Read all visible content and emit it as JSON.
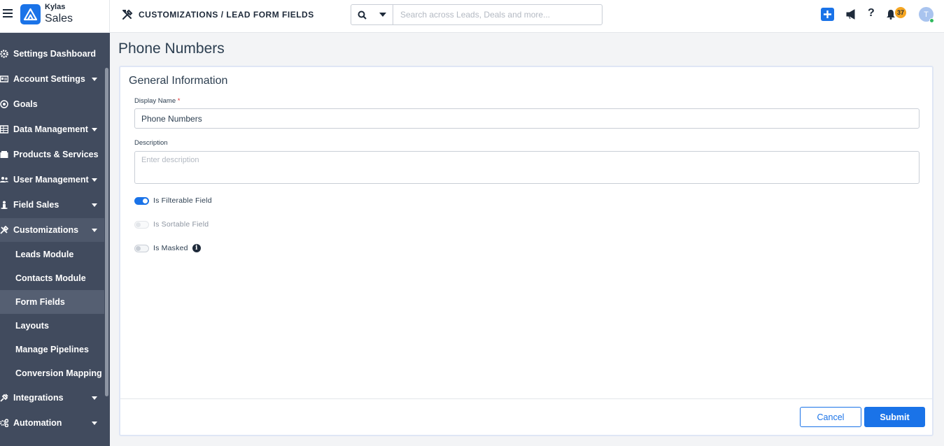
{
  "header": {
    "brand_small": "Kylas",
    "brand_big": "Sales",
    "breadcrumb": "CUSTOMIZATIONS / LEAD FORM FIELDS",
    "search_placeholder": "Search across Leads, Deals and more...",
    "notification_count": "37",
    "avatar_initial": "T"
  },
  "sidebar": {
    "items": [
      {
        "label": "Settings Dashboard",
        "icon": "gear-icon",
        "has_caret": false
      },
      {
        "label": "Account Settings",
        "icon": "id-card-icon",
        "has_caret": true
      },
      {
        "label": "Goals",
        "icon": "target-icon",
        "has_caret": false
      },
      {
        "label": "Data Management",
        "icon": "table-icon",
        "has_caret": true
      },
      {
        "label": "Products & Services",
        "icon": "box-icon",
        "has_caret": false
      },
      {
        "label": "User Management",
        "icon": "users-icon",
        "has_caret": true
      },
      {
        "label": "Field Sales",
        "icon": "person-pin-icon",
        "has_caret": true
      },
      {
        "label": "Customizations",
        "icon": "tools-icon",
        "has_caret": true,
        "active": true
      },
      {
        "label": "Integrations",
        "icon": "plug-icon",
        "has_caret": true
      },
      {
        "label": "Automation",
        "icon": "cogs-icon",
        "has_caret": true
      }
    ],
    "customizations_sub": [
      {
        "label": "Leads Module"
      },
      {
        "label": "Contacts Module"
      },
      {
        "label": "Form Fields",
        "active": true
      },
      {
        "label": "Layouts"
      },
      {
        "label": "Manage Pipelines"
      },
      {
        "label": "Conversion Mapping"
      }
    ]
  },
  "main": {
    "page_title": "Phone Numbers",
    "section_title": "General Information",
    "display_name_label": "Display Name",
    "display_name_required": "*",
    "display_name_value": "Phone Numbers",
    "description_label": "Description",
    "description_placeholder": "Enter description",
    "toggles": [
      {
        "label": "Is Filterable Field",
        "on": true,
        "disabled": false
      },
      {
        "label": "Is Sortable Field",
        "on": false,
        "disabled": true
      },
      {
        "label": "Is Masked",
        "on": false,
        "disabled": false,
        "info": true
      }
    ],
    "cancel_label": "Cancel",
    "submit_label": "Submit"
  },
  "colors": {
    "primary": "#1a73e8",
    "sidebar_bg": "#414b5e",
    "badge": "#f5a623"
  }
}
